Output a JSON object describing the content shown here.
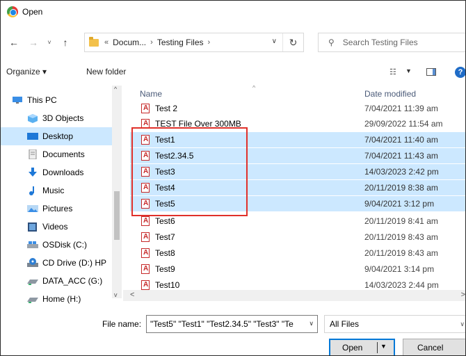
{
  "window": {
    "title": "Open"
  },
  "nav": {
    "back_icon": "←",
    "forward_icon": "→",
    "recent_icon": "˅",
    "up_icon": "↑",
    "breadcrumb_prefix": "«",
    "breadcrumbs": [
      "Docum...",
      "Testing Files"
    ],
    "crumb_sep": "›",
    "dropdown_icon": "∨",
    "refresh_icon": "↻",
    "search_placeholder": "Search Testing Files"
  },
  "toolbar": {
    "organize": "Organize ▾",
    "new_folder": "New folder",
    "view_icon": "☷",
    "view_drop": "▼",
    "help": "?"
  },
  "sidebar": {
    "items": [
      {
        "label": "This PC",
        "icon": "computer-icon",
        "selected": false
      },
      {
        "label": "3D Objects",
        "icon": "cube-icon",
        "selected": false
      },
      {
        "label": "Desktop",
        "icon": "desktop-icon",
        "selected": true
      },
      {
        "label": "Documents",
        "icon": "document-icon",
        "selected": false
      },
      {
        "label": "Downloads",
        "icon": "download-icon",
        "selected": false
      },
      {
        "label": "Music",
        "icon": "music-icon",
        "selected": false
      },
      {
        "label": "Pictures",
        "icon": "pictures-icon",
        "selected": false
      },
      {
        "label": "Videos",
        "icon": "video-icon",
        "selected": false
      },
      {
        "label": "OSDisk (C:)",
        "icon": "drive-icon",
        "selected": false
      },
      {
        "label": "CD Drive (D:) HP",
        "icon": "cd-drive-icon",
        "selected": false
      },
      {
        "label": "DATA_ACC (G:)",
        "icon": "network-drive-icon",
        "selected": false
      },
      {
        "label": "Home (H:)",
        "icon": "network-drive-icon",
        "selected": false
      }
    ],
    "scroll_up": "^",
    "scroll_down": "v"
  },
  "files": {
    "columns": {
      "name": "Name",
      "date": "Date modified"
    },
    "sort_icon": "^",
    "rows": [
      {
        "name": "Test 2",
        "date": "7/04/2021 11:39 am",
        "selected": false
      },
      {
        "name": "TEST File Over 300MB",
        "date": "29/09/2022 11:54 am",
        "selected": false
      },
      {
        "name": "Test1",
        "date": "7/04/2021 11:40 am",
        "selected": true
      },
      {
        "name": "Test2.34.5",
        "date": "7/04/2021 11:43 am",
        "selected": true
      },
      {
        "name": "Test3",
        "date": "14/03/2023 2:42 pm",
        "selected": true
      },
      {
        "name": "Test4",
        "date": "20/11/2019 8:38 am",
        "selected": true
      },
      {
        "name": "Test5",
        "date": "9/04/2021 3:12 pm",
        "selected": true
      },
      {
        "name": "Test6",
        "date": "20/11/2019 8:41 am",
        "selected": false
      },
      {
        "name": "Test7",
        "date": "20/11/2019 8:43 am",
        "selected": false
      },
      {
        "name": "Test8",
        "date": "20/11/2019 8:43 am",
        "selected": false
      },
      {
        "name": "Test9",
        "date": "9/04/2021 3:14 pm",
        "selected": false
      },
      {
        "name": "Test10",
        "date": "14/03/2023 2:44 pm",
        "selected": false
      }
    ]
  },
  "hscroll": {
    "left": "<",
    "right": ">"
  },
  "footer": {
    "file_name_label": "File name:",
    "file_name_value": "\"Test5\" \"Test1\" \"Test2.34.5\" \"Test3\" \"Te",
    "file_name_drop": "∨",
    "filter_value": "All Files",
    "filter_drop": "∨",
    "open_label": "Open",
    "open_arrow": "▼",
    "cancel_label": "Cancel"
  }
}
